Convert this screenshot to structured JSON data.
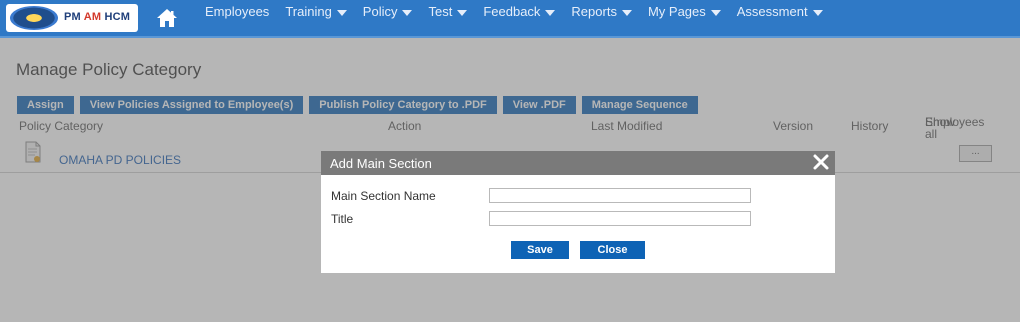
{
  "logo": {
    "text_pm": "PM ",
    "text_am": "AM",
    "text_hcm": " HCM"
  },
  "nav": {
    "items": [
      {
        "label": "Employees",
        "has_caret": false
      },
      {
        "label": "Training",
        "has_caret": true
      },
      {
        "label": "Policy",
        "has_caret": true
      },
      {
        "label": "Test",
        "has_caret": true
      },
      {
        "label": "Feedback",
        "has_caret": true
      },
      {
        "label": "Reports",
        "has_caret": true
      },
      {
        "label": "My Pages",
        "has_caret": true
      },
      {
        "label": "Assessment",
        "has_caret": true
      }
    ]
  },
  "page": {
    "title": "Manage Policy Category"
  },
  "toolbar": {
    "assign": "Assign",
    "view_assigned": "View Policies Assigned to Employee(s)",
    "publish_pdf": "Publish Policy Category to .PDF",
    "view_pdf": "View .PDF",
    "manage_sequence": "Manage Sequence"
  },
  "table": {
    "headers": {
      "policy_category": "Policy Category",
      "action": "Action",
      "last_modified": "Last Modified",
      "version": "Version",
      "history": "History",
      "show_all_line1": "Show all",
      "show_all_line2": "Employees"
    },
    "rows": [
      {
        "policy_category": "OMAHA PD POLICIES",
        "show_all": "..."
      }
    ]
  },
  "modal": {
    "title": "Add Main Section",
    "main_section_label": "Main Section Name",
    "main_section_value": "",
    "title_label": "Title",
    "title_value": "",
    "save": "Save",
    "close": "Close"
  },
  "colors": {
    "nav_bar": "#2f79c6",
    "button": "#0e63b5",
    "modal_header": "#7a7a7a",
    "link": "#1a5db0"
  },
  "icons": {
    "home": "home-icon",
    "close": "close-icon",
    "document": "document-icon",
    "caret": "caret-down-icon"
  }
}
